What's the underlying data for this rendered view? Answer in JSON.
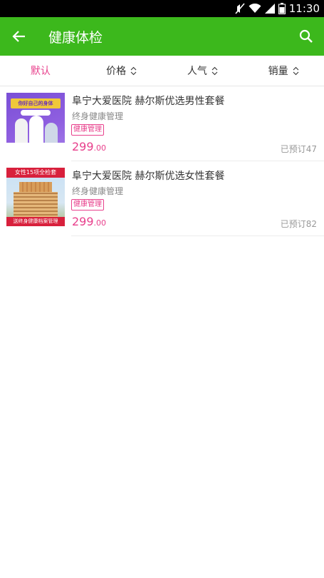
{
  "status_bar": {
    "time": "11:30",
    "icons": [
      "mute-icon",
      "wifi-icon",
      "signal-icon",
      "battery-icon"
    ]
  },
  "app_bar": {
    "title": "健康体检",
    "back_icon": "arrow-left-icon",
    "search_icon": "search-icon",
    "background": "#3cb81c"
  },
  "sort_bar": {
    "items": [
      {
        "label": "默认",
        "active": true
      },
      {
        "label": "价格",
        "active": false
      },
      {
        "label": "人气",
        "active": false
      },
      {
        "label": "销量",
        "active": false
      }
    ],
    "accent": "#e8408c"
  },
  "products": [
    {
      "name": "阜宁大爱医院 赫尔斯优选男性套餐",
      "subtitle": "终身健康管理",
      "tag": "健康管理",
      "price_int": "299",
      "price_dec": ".00",
      "booked": "已预订47",
      "thumb_text": "你好自己的身体"
    },
    {
      "name": "阜宁大爱医院 赫尔斯优选女性套餐",
      "subtitle": "终身健康管理",
      "tag": "健康管理",
      "price_int": "299",
      "price_dec": ".00",
      "booked": "已预订82",
      "thumb_text": "女性15项全检套",
      "thumb_bottom_text": "送终身健康档案管理"
    }
  ]
}
